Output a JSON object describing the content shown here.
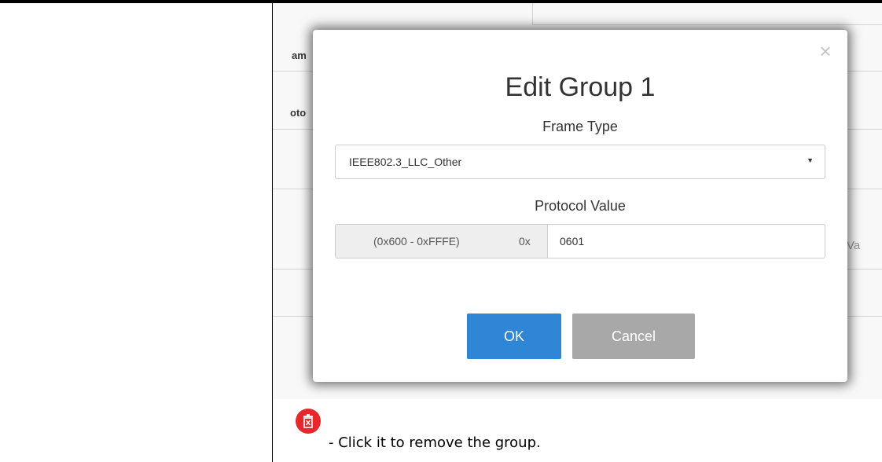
{
  "background": {
    "label_1": "am",
    "label_2": "oto",
    "label_3": "Va"
  },
  "dialog": {
    "close_label": "×",
    "title": "Edit Group 1",
    "frame_type": {
      "label": "Frame Type",
      "selected": "IEEE802.3_LLC_Other",
      "caret": "▼"
    },
    "protocol_value": {
      "label": "Protocol Value",
      "range": "(0x600 - 0xFFFE)",
      "prefix": "0x",
      "value": "0601"
    },
    "ok_label": "OK",
    "cancel_label": "Cancel"
  },
  "instruction": {
    "icon": "trash-icon",
    "icon_color": "#e8262b",
    "text": "- Click it to remove the group."
  },
  "colors": {
    "ok_button": "#2f86d6",
    "cancel_button": "#a8a8a8"
  }
}
